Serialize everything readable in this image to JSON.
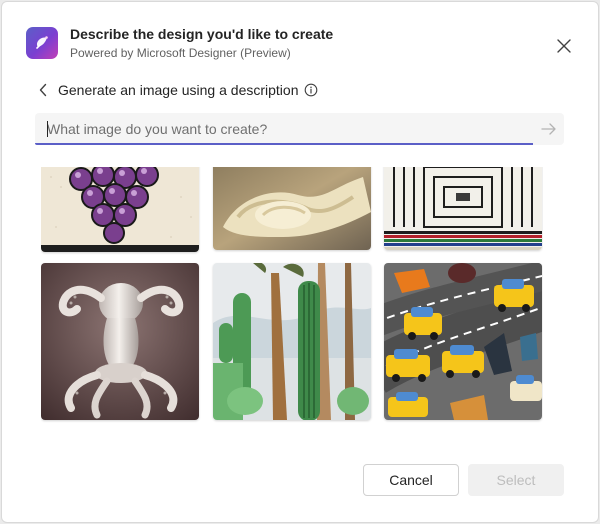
{
  "header": {
    "title": "Describe the design you'd like to create",
    "subtitle": "Powered by Microsoft Designer (Preview)",
    "logo_icon": "designer-logo-icon",
    "close_icon": "close-icon"
  },
  "subheader": {
    "title": "Generate an image using a description",
    "back_icon": "chevron-left-icon",
    "info_icon": "info-icon"
  },
  "prompt": {
    "value": "",
    "placeholder": "What image do you want to create?",
    "send_icon": "arrow-right-icon"
  },
  "gallery": {
    "images": [
      {
        "subject": "grapes illustration"
      },
      {
        "subject": "cream dessert swirl"
      },
      {
        "subject": "patterned textile"
      },
      {
        "subject": "ceramic octopus vase"
      },
      {
        "subject": "cactus collage"
      },
      {
        "subject": "felt taxi cars collage"
      }
    ]
  },
  "footer": {
    "cancel_label": "Cancel",
    "select_label": "Select"
  },
  "colors": {
    "accent": "#5b5fc7",
    "disabled_bg": "#f0f0f0",
    "disabled_text": "#bdbdbd"
  }
}
